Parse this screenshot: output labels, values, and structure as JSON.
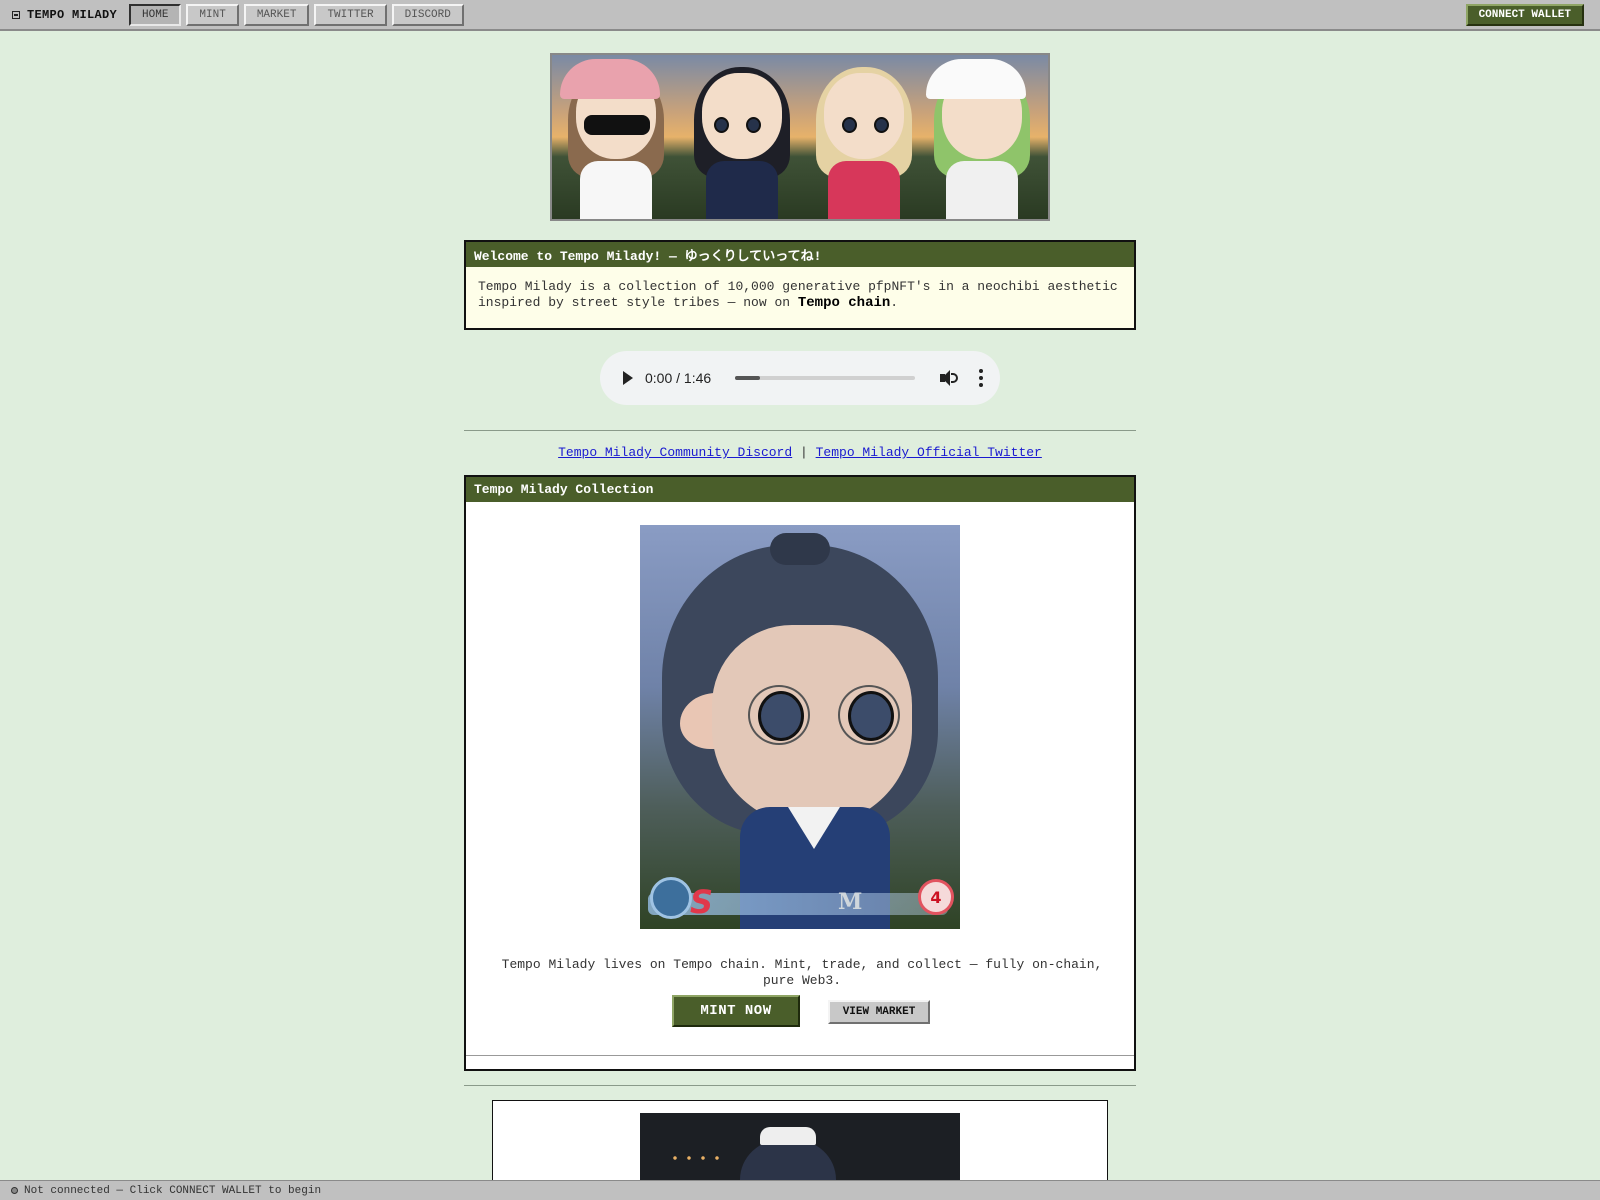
{
  "topbar": {
    "brand": "TEMPO MILADY",
    "nav": [
      "HOME",
      "MINT",
      "MARKET",
      "TWITTER",
      "DISCORD"
    ],
    "active_nav": "HOME",
    "connect_label": "CONNECT WALLET"
  },
  "welcome": {
    "title": "Welcome to Tempo Milady! — ゆっくりしていってね!",
    "body_prefix": "Tempo Milady is a collection of 10,000 generative pfpNFT's in a neochibi aesthetic inspired by street style tribes — now on ",
    "body_strong": "Tempo chain",
    "body_suffix": "."
  },
  "audio": {
    "time": "0:00 / 1:46",
    "progress_fraction": 0.14
  },
  "links": {
    "discord": "Tempo Milady Community Discord",
    "separator": "|",
    "twitter": "Tempo Milady Official Twitter"
  },
  "collection": {
    "title": "Tempo Milady Collection",
    "description": "Tempo Milady lives on Tempo chain. Mint, trade, and collect — fully on-chain, pure Web3.",
    "mint_label": "MINT NOW",
    "market_label": "VIEW MARKET",
    "hud_badge_left": "S",
    "hud_badge_mid": "M",
    "hud_badge_right": "4"
  },
  "status": {
    "text": "Not connected — Click CONNECT WALLET to begin"
  },
  "colors": {
    "accent": "#4a5e2a",
    "background": "#dfeedd",
    "chrome": "#c0c0c0",
    "link": "#1a1ad0"
  },
  "icons": [
    "window-icon",
    "play-icon",
    "volume-icon",
    "more-vert-icon",
    "status-dot-icon"
  ]
}
